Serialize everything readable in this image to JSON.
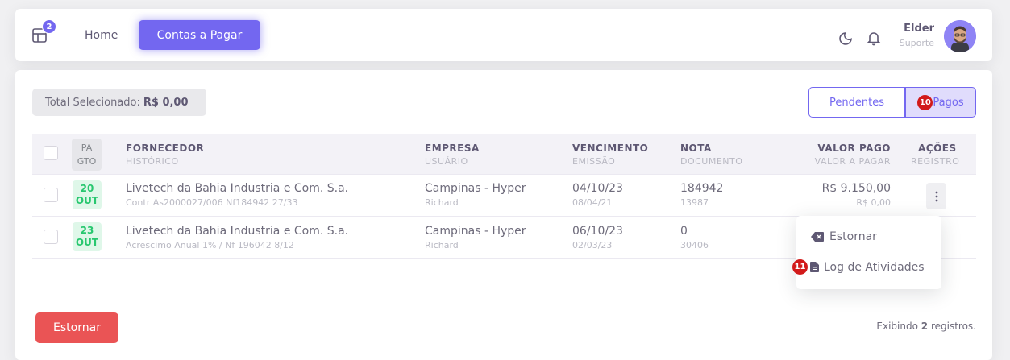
{
  "topbar": {
    "grid_badge": "2",
    "nav_home": "Home",
    "nav_active": "Contas a Pagar",
    "user_name": "Elder",
    "user_role": "Suporte"
  },
  "filters": {
    "total_label": "Total Selecionado:",
    "total_value": "R$ 0,00",
    "tab_pendentes": "Pendentes",
    "tab_pagos": "Pagos",
    "tab_pagos_step": "10"
  },
  "table": {
    "headers": {
      "pagto_line1": "PA",
      "pagto_line2": "GTO",
      "fornecedor": "FORNECEDOR",
      "historico": "HISTÓRICO",
      "empresa": "EMPRESA",
      "usuario": "USUÁRIO",
      "vencimento": "VENCIMENTO",
      "emissao": "EMISSÃO",
      "nota": "NOTA",
      "documento": "DOCUMENTO",
      "valor_pago": "VALOR PAGO",
      "valor_a_pagar": "VALOR A PAGAR",
      "acoes": "AÇÕES",
      "registro": "REGISTRO"
    },
    "rows": [
      {
        "day": "20",
        "month": "OUT",
        "fornecedor": "Livetech da Bahia Industria e Com. S.a.",
        "historico": "Contr As2000027/006 Nf184942 27/33",
        "empresa": "Campinas - Hyper",
        "usuario": "Richard",
        "vencimento": "04/10/23",
        "emissao": "08/04/21",
        "nota": "184942",
        "documento": "13987",
        "valor_pago": "R$ 9.150,00",
        "valor_a_pagar": "R$ 0,00"
      },
      {
        "day": "23",
        "month": "OUT",
        "fornecedor": "Livetech da Bahia Industria e Com. S.a.",
        "historico": "Acrescimo Anual 1% / Nf 196042 8/12",
        "empresa": "Campinas - Hyper",
        "usuario": "Richard",
        "vencimento": "06/10/23",
        "emissao": "02/03/23",
        "nota": "0",
        "documento": "30406"
      }
    ]
  },
  "dropdown": {
    "estornar": "Estornar",
    "log": "Log de Atividades",
    "log_step": "11"
  },
  "footer": {
    "estornar_button": "Estornar",
    "count_prefix": "Exibindo",
    "count_value": "2",
    "count_suffix": "registros."
  },
  "colors": {
    "primary": "#7367f0",
    "danger": "#ea5455",
    "success": "#28c76f",
    "step_badge": "#d21a1a"
  }
}
